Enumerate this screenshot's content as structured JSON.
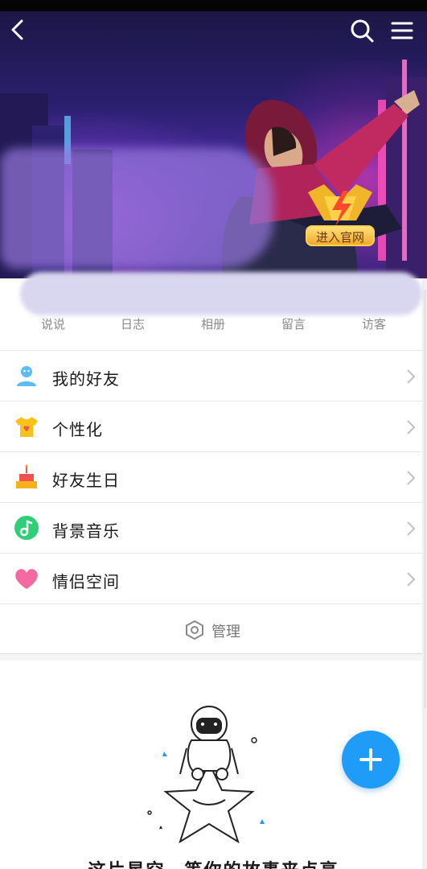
{
  "hero": {
    "badge_label": "进入官网"
  },
  "stats": [
    {
      "label": "说说"
    },
    {
      "label": "日志"
    },
    {
      "label": "相册"
    },
    {
      "label": "留言"
    },
    {
      "label": "访客"
    }
  ],
  "menu": [
    {
      "label": "我的好友",
      "icon": "friends-icon",
      "color": "#5bbcf2"
    },
    {
      "label": "个性化",
      "icon": "personalize-shirt-icon",
      "color": "#f8c21a"
    },
    {
      "label": "好友生日",
      "icon": "birthday-cake-icon",
      "color": "#f6b21c"
    },
    {
      "label": "背景音乐",
      "icon": "music-note-icon",
      "color": "#2fcf7a"
    },
    {
      "label": "情侣空间",
      "icon": "heart-icon",
      "color": "#f46aa0"
    }
  ],
  "manage": {
    "label": "管理",
    "icon": "settings-hexagon-icon"
  },
  "empty_state": {
    "text": "这片星空，等你的故事来点亮"
  },
  "colors": {
    "accent": "#1e9cf7",
    "chevron": "#c0c0c0"
  }
}
